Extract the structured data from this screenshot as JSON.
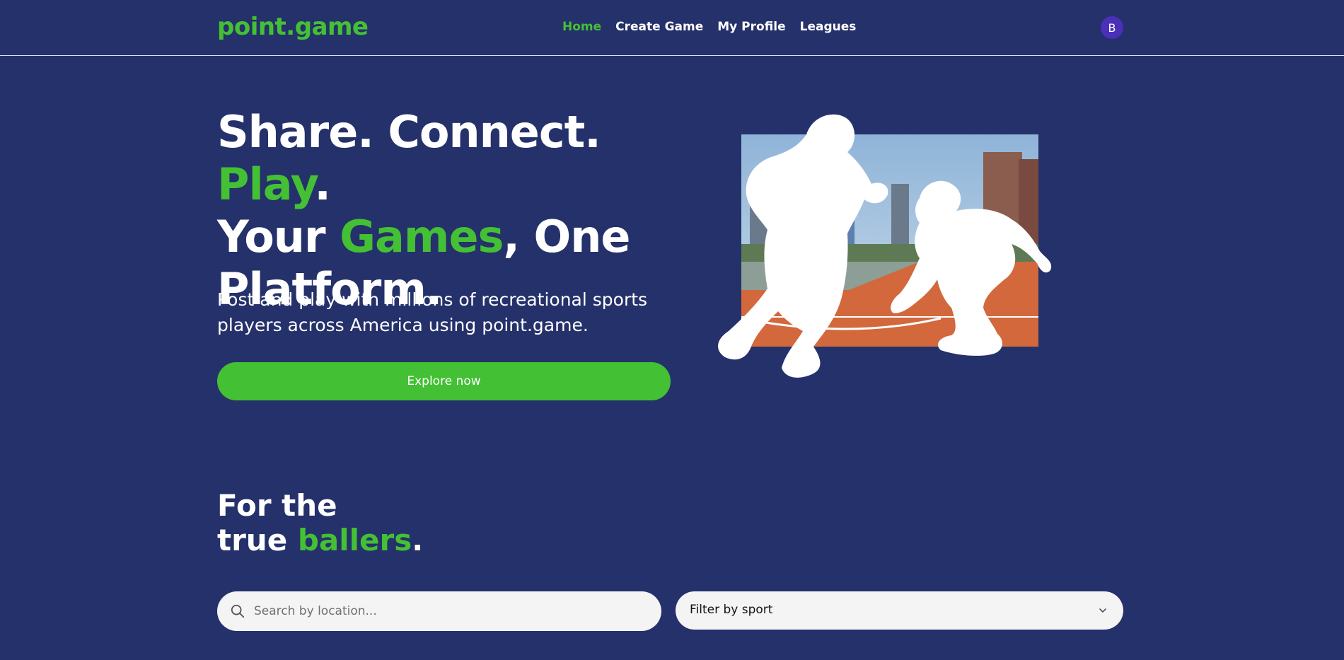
{
  "header": {
    "logo": "point.game",
    "nav": [
      {
        "label": "Home",
        "active": true
      },
      {
        "label": "Create Game",
        "active": false
      },
      {
        "label": "My Profile",
        "active": false
      },
      {
        "label": "Leagues",
        "active": false
      }
    ],
    "avatar_initial": "B"
  },
  "hero": {
    "title_parts": {
      "share": "Share. Connect. ",
      "play": "Play",
      "dot1": ".",
      "your": "Your ",
      "games": "Games",
      "one_platform": ", One Platform."
    },
    "subtitle": "Post and play with millions of recreational sports players across America using point.game.",
    "cta_label": "Explore now",
    "image_icon": "basketball-players-illustration"
  },
  "section": {
    "title_line1": "For the",
    "title_true": "true ",
    "title_ballers": "ballers",
    "title_dot": "."
  },
  "search": {
    "placeholder": "Search by location...",
    "icon": "search-icon"
  },
  "filter": {
    "label": "Filter by sport",
    "icon": "chevron-down-icon"
  },
  "colors": {
    "background": "#25316a",
    "accent": "#44c035",
    "avatar": "#4a2fb8"
  }
}
